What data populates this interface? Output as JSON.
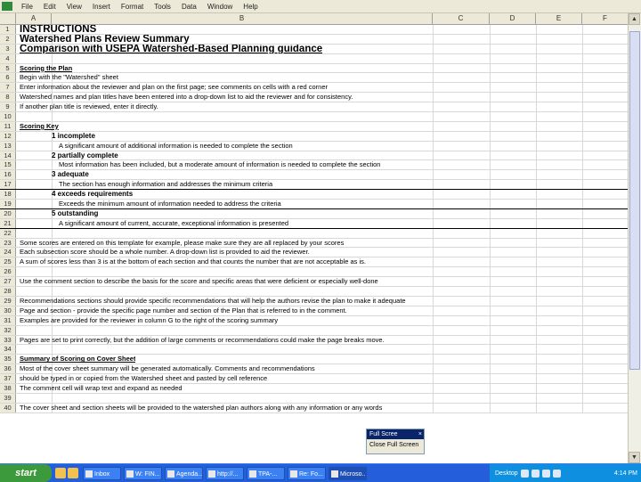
{
  "menu": [
    "File",
    "Edit",
    "View",
    "Insert",
    "Format",
    "Tools",
    "Data",
    "Window",
    "Help"
  ],
  "columns": [
    "A",
    "B",
    "C",
    "D",
    "E",
    "F"
  ],
  "rows": [
    {
      "n": "1",
      "text": "INSTRUCTIONS",
      "style": "big"
    },
    {
      "n": "2",
      "text": "Watershed Plans Review Summary",
      "style": "big"
    },
    {
      "n": "3",
      "text": "Comparison with USEPA Watershed-Based Planning guidance",
      "style": "big-u"
    },
    {
      "n": "4",
      "text": ""
    },
    {
      "n": "5",
      "text": "Scoring the Plan",
      "style": "hd"
    },
    {
      "n": "6",
      "text": "Begin with the \"Watershed\" sheet"
    },
    {
      "n": "7",
      "text": "Enter information about the reviewer and plan on the first page; see comments on cells with a red corner"
    },
    {
      "n": "8",
      "text": "Watershed names and plan titles have been entered into a drop-down list to aid the reviewer and for consistency."
    },
    {
      "n": "9",
      "text": "If another plan title is reviewed, enter it directly."
    },
    {
      "n": "10",
      "text": ""
    },
    {
      "n": "11",
      "text": "Scoring Key",
      "style": "hd"
    },
    {
      "n": "12",
      "text": "1 incomplete",
      "style": "lvl",
      "indent": 36
    },
    {
      "n": "13",
      "text": "A significant amount of additional information is needed to complete the section",
      "indent": 44
    },
    {
      "n": "14",
      "text": "2 partially complete",
      "style": "lvl",
      "indent": 36
    },
    {
      "n": "15",
      "text": "Most information has been included, but a moderate amount of information is needed to complete the section",
      "indent": 44
    },
    {
      "n": "16",
      "text": "3 adequate",
      "style": "lvl",
      "indent": 36
    },
    {
      "n": "17",
      "text": "The section has enough information and addresses the minimum criteria",
      "indent": 44,
      "rule": true
    },
    {
      "n": "18",
      "text": "4 exceeds requirements",
      "style": "lvl",
      "indent": 36
    },
    {
      "n": "19",
      "text": "Exceeds the minimum amount of information needed to address the criteria",
      "indent": 44,
      "rule": true
    },
    {
      "n": "20",
      "text": "5 outstanding",
      "style": "lvl",
      "indent": 36
    },
    {
      "n": "21",
      "text": "A significant amount of current, accurate, exceptional information is presented",
      "indent": 44,
      "rule": true
    },
    {
      "n": "22",
      "text": ""
    },
    {
      "n": "23",
      "text": "Some scores are entered on this template for example, please make sure they are all replaced by your scores"
    },
    {
      "n": "24",
      "text": "Each subsection score should be a whole number.  A drop-down list is provided to aid the reviewer."
    },
    {
      "n": "25",
      "text": "A sum of scores less than 3 is at the bottom of each section and that counts the number that are not acceptable as is."
    },
    {
      "n": "26",
      "text": ""
    },
    {
      "n": "27",
      "text": "Use the comment section to describe the basis for the score and specific areas that were deficient or especially well-done"
    },
    {
      "n": "28",
      "text": ""
    },
    {
      "n": "29",
      "text": "Recommendations sections should provide specific recommendations that will help the authors revise the plan to make it adequate"
    },
    {
      "n": "30",
      "text": "Page and section - provide the specific page number and section of the Plan that is referred to in the comment."
    },
    {
      "n": "31",
      "text": "Examples are provided for the reviewer in column G to the right of the scoring summary"
    },
    {
      "n": "32",
      "text": ""
    },
    {
      "n": "33",
      "text": "Pages are set to print correctly, but the addition of large comments or recommendations could make the page breaks move."
    },
    {
      "n": "34",
      "text": ""
    },
    {
      "n": "35",
      "text": "Summary of Scoring on Cover Sheet",
      "style": "hd"
    },
    {
      "n": "36",
      "text": "Most of the cover sheet summary will be generated automatically.  Comments and recommendations"
    },
    {
      "n": "37",
      "text": "should be typed in or copied from the Watershed sheet and pasted by cell reference"
    },
    {
      "n": "38",
      "text": "The comment cell will wrap text and expand as needed"
    },
    {
      "n": "39",
      "text": ""
    },
    {
      "n": "40",
      "text": "The cover sheet and section sheets will be provided to the watershed plan authors along with any information or any words"
    }
  ],
  "fullscreen": {
    "title": "Full Scree",
    "close": "Close Full Screen"
  },
  "taskbar": {
    "start": "start",
    "buttons": [
      "Inbox",
      "W: FIN...",
      "Agenda...",
      "http://...",
      "TPA-...",
      "Re: Fo...",
      "Microso..."
    ],
    "tray_label": "Desktop",
    "clock": "4:14 PM"
  }
}
